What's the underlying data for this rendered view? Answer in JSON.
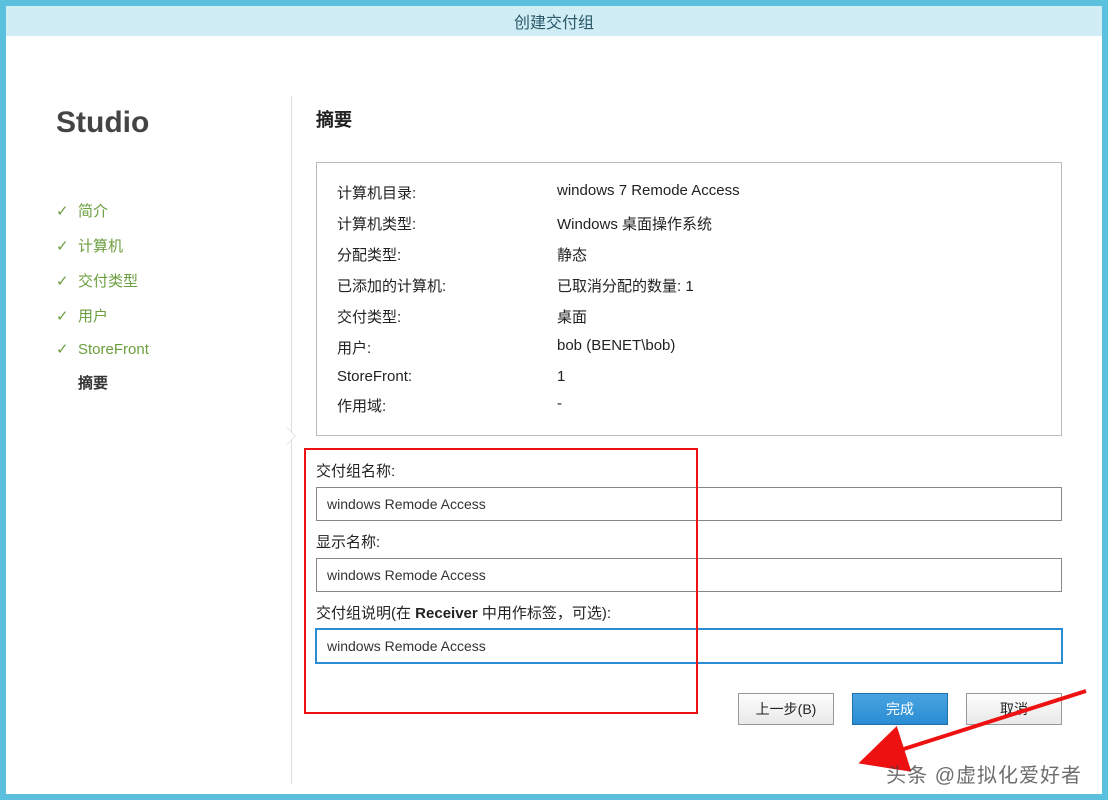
{
  "window": {
    "title": "创建交付组"
  },
  "brand": "Studio",
  "steps": [
    {
      "label": "简介",
      "done": true,
      "current": false
    },
    {
      "label": "计算机",
      "done": true,
      "current": false
    },
    {
      "label": "交付类型",
      "done": true,
      "current": false
    },
    {
      "label": "用户",
      "done": true,
      "current": false
    },
    {
      "label": "StoreFront",
      "done": true,
      "current": false
    },
    {
      "label": "摘要",
      "done": false,
      "current": true
    }
  ],
  "page": {
    "title": "摘要"
  },
  "summary": [
    {
      "label": "计算机目录:",
      "value": "windows 7 Remode Access"
    },
    {
      "label": "计算机类型:",
      "value": "Windows 桌面操作系统"
    },
    {
      "label": "分配类型:",
      "value": "静态"
    },
    {
      "label": "已添加的计算机:",
      "value": "已取消分配的数量: 1"
    },
    {
      "label": "交付类型:",
      "value": "桌面"
    },
    {
      "label": "用户:",
      "value": "bob (BENET\\bob)"
    },
    {
      "label": "StoreFront:",
      "value": "1"
    },
    {
      "label": "作用域:",
      "value": "-"
    }
  ],
  "fields": {
    "group_name": {
      "label": "交付组名称:",
      "value": "windows Remode Access"
    },
    "display_name": {
      "label": "显示名称:",
      "value": "windows Remode Access"
    },
    "description": {
      "label_prefix": "交付组说明(在 ",
      "label_bold": "Receiver",
      "label_suffix": " 中用作标签，可选):",
      "value": "windows Remode Access"
    }
  },
  "buttons": {
    "back": "上一步(B)",
    "finish": "完成",
    "cancel": "取消"
  },
  "watermark": "头条 @虚拟化爱好者"
}
